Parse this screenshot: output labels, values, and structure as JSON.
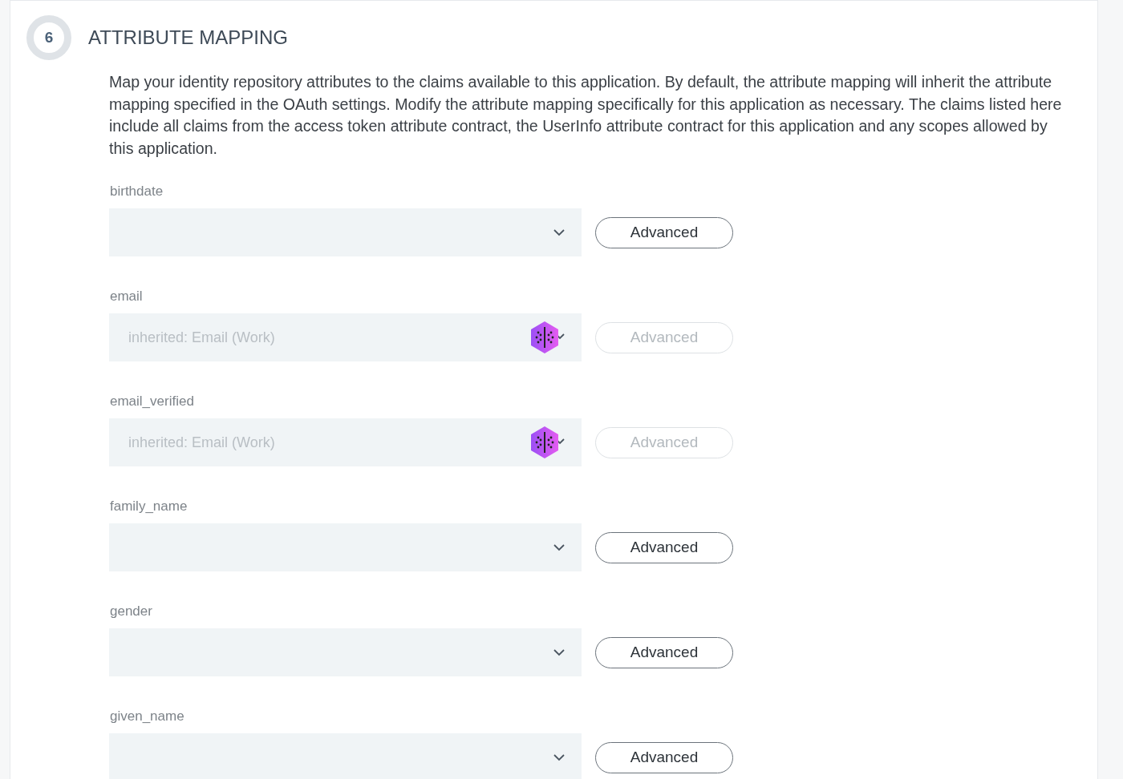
{
  "section": {
    "number": "6",
    "title": "ATTRIBUTE MAPPING",
    "description": "Map your identity repository attributes to the claims available to this application. By default, the attribute mapping will inherit the attribute mapping specified in the OAuth settings. Modify the attribute mapping specifically for this application as necessary. The claims listed here include all claims from the access token attribute contract, the UserInfo attribute contract for this application and any scopes allowed by this application."
  },
  "rows": [
    {
      "label": "birthdate",
      "disabled": false,
      "button": "Advanced"
    },
    {
      "label": "email",
      "value": "inherited: Email (Work)",
      "disabled": true,
      "button": "Advanced"
    },
    {
      "label": "email_verified",
      "value": "inherited: Email (Work)",
      "disabled": true,
      "button": "Advanced"
    },
    {
      "label": "family_name",
      "disabled": false,
      "button": "Advanced"
    },
    {
      "label": "gender",
      "disabled": false,
      "button": "Advanced"
    },
    {
      "label": "given_name",
      "disabled": false,
      "button": "Advanced"
    }
  ]
}
